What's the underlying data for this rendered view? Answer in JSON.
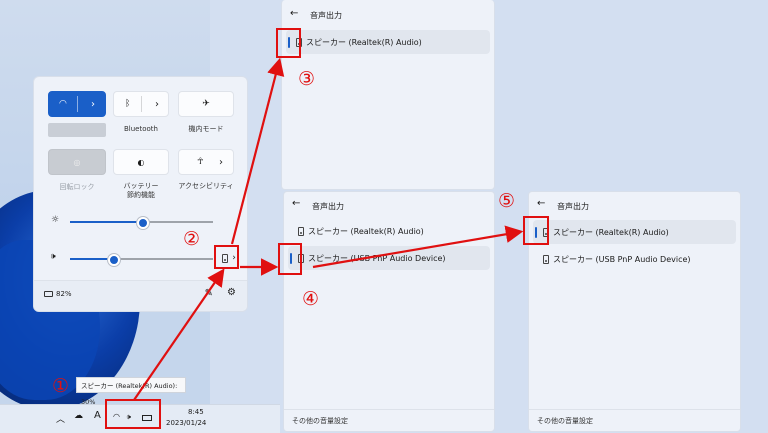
{
  "quick_settings": {
    "bluetooth_label": "Bluetooth",
    "airplane_label": "機内モード",
    "rotation_lock_label": "回転ロック",
    "battery_saver_label": "バッテリー\n節約機能",
    "accessibility_label": "アクセシビリティ",
    "battery_text": "82%",
    "brightness_value": 0.5,
    "volume_value": 0.3
  },
  "audio_panel_1": {
    "title": "音声出力",
    "device_1": "スピーカー (Realtek(R) Audio)"
  },
  "audio_panel_2": {
    "title": "音声出力",
    "device_1": "スピーカー (Realtek(R) Audio)",
    "device_2": "スピーカー (USB PnP Audio Device)",
    "footer": "その他の音量設定"
  },
  "audio_panel_3": {
    "title": "音声出力",
    "device_1": "スピーカー (Realtek(R) Audio)",
    "device_2": "スピーカー (USB PnP Audio Device)",
    "footer": "その他の音量設定"
  },
  "tooltip": "スピーカー (Realtek(R) Audio): 30%",
  "taskbar": {
    "time": "8:45",
    "date": "2023/01/24",
    "ime": "A"
  },
  "steps": {
    "s1": "①",
    "s2": "②",
    "s3": "③",
    "s4": "④",
    "s5": "⑤"
  },
  "colors": {
    "accent": "#1a5fc8",
    "annotation": "#e01010"
  }
}
